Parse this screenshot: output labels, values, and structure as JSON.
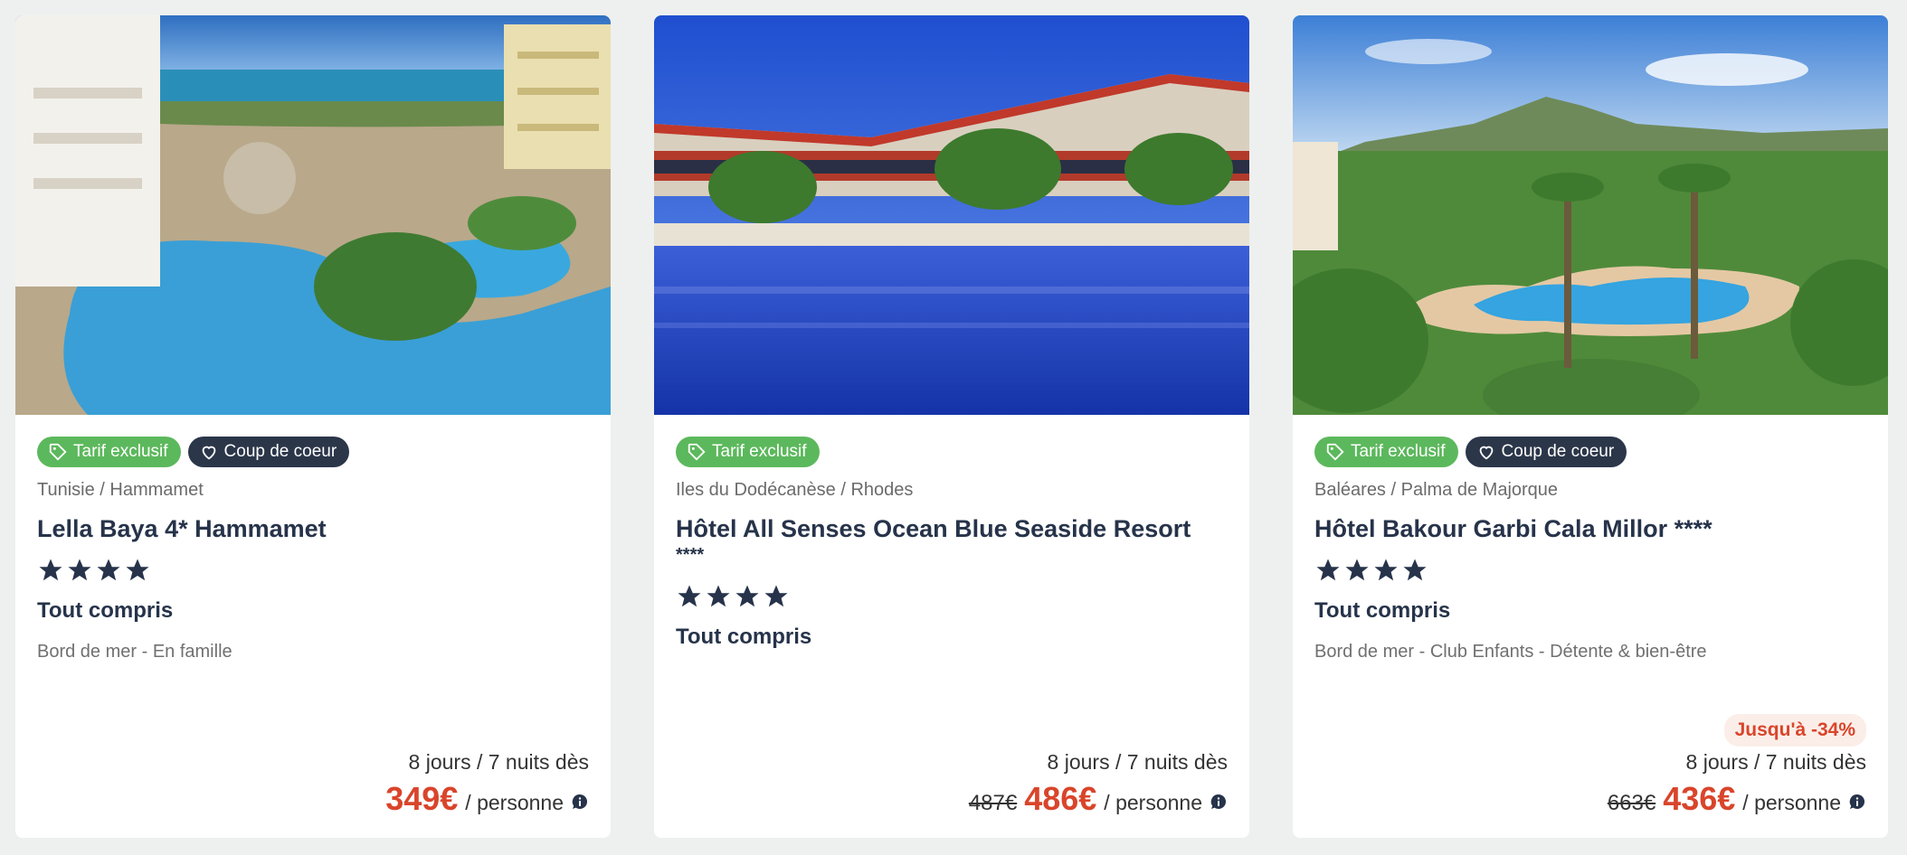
{
  "cards": [
    {
      "badges": {
        "exclusive": "Tarif exclusif",
        "favorite": "Coup de coeur"
      },
      "location": "Tunisie / Hammamet",
      "title": "Lella Baya 4* Hammamet",
      "stars": 4,
      "board": "Tout compris",
      "tags": "Bord de mer - En famille",
      "discount": "",
      "duration": "8 jours / 7 nuits dès",
      "old_price": "",
      "price": "349€",
      "per": "/ personne"
    },
    {
      "badges": {
        "exclusive": "Tarif exclusif"
      },
      "location": "Iles du Dodécanèse / Rhodes",
      "title": "Hôtel All Senses Ocean Blue Seaside Resort",
      "title_suffix": "****",
      "stars": 4,
      "board": "Tout compris",
      "tags": "",
      "discount": "",
      "duration": "8 jours / 7 nuits dès",
      "old_price": "487€",
      "price": "486€",
      "per": "/ personne"
    },
    {
      "badges": {
        "exclusive": "Tarif exclusif",
        "favorite": "Coup de coeur"
      },
      "location": "Baléares / Palma de Majorque",
      "title": "Hôtel Bakour Garbi Cala Millor ****",
      "stars": 4,
      "board": "Tout compris",
      "tags": "Bord de mer - Club Enfants - Détente & bien-être",
      "discount": "Jusqu'à -34%",
      "duration": "8 jours / 7 nuits dès",
      "old_price": "663€",
      "price": "436€",
      "per": "/ personne"
    }
  ],
  "colors": {
    "accent_price": "#d9452b",
    "badge_green": "#5cb85c",
    "badge_dark": "#2b3649",
    "text": "#26334a"
  },
  "icons": {
    "exclusive": "tag-icon",
    "favorite": "heart-icon",
    "rating": "star-icon",
    "info": "info-icon"
  }
}
